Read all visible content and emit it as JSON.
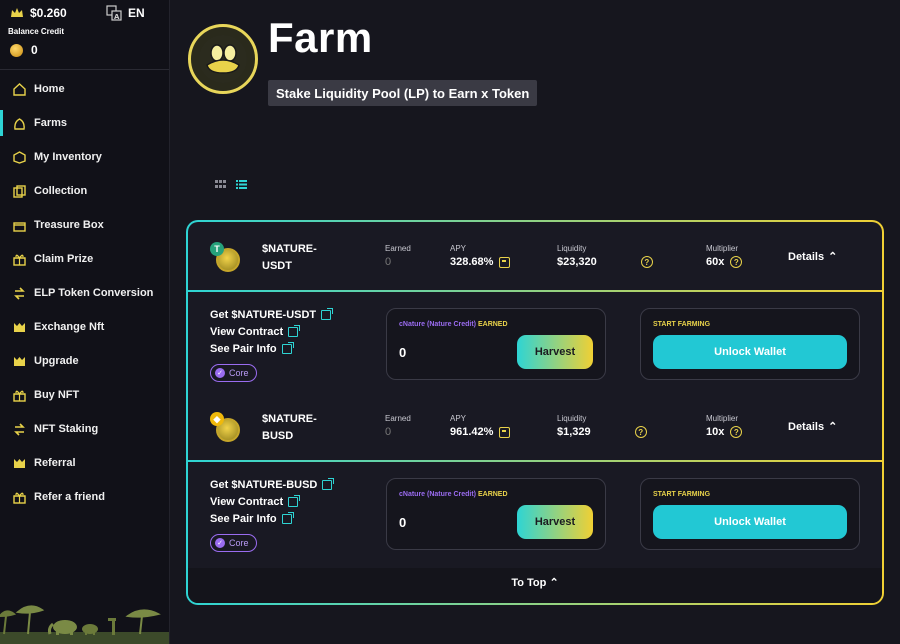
{
  "header_bar": {
    "price": "$0.260",
    "language": "EN",
    "balance_label": "Balance Credit",
    "balance_value": "0"
  },
  "sidebar": {
    "items": [
      {
        "label": "Home",
        "icon": "home-icon"
      },
      {
        "label": "Farms",
        "icon": "farm-icon",
        "active": true
      },
      {
        "label": "My Inventory",
        "icon": "inventory-icon"
      },
      {
        "label": "Collection",
        "icon": "collection-icon"
      },
      {
        "label": "Treasure Box",
        "icon": "treasure-box-icon"
      },
      {
        "label": "Claim Prize",
        "icon": "gift-icon"
      },
      {
        "label": "ELP Token Conversion",
        "icon": "conversion-icon"
      },
      {
        "label": "Exchange Nft",
        "icon": "exchange-icon"
      },
      {
        "label": "Upgrade",
        "icon": "upgrade-icon"
      },
      {
        "label": "Buy NFT",
        "icon": "gift-icon"
      },
      {
        "label": "NFT Staking",
        "icon": "staking-icon"
      },
      {
        "label": "Referral",
        "icon": "referral-icon"
      },
      {
        "label": "Refer a friend",
        "icon": "gift-icon"
      }
    ]
  },
  "page": {
    "title": "Farm",
    "subtitle": "Stake Liquidity Pool (LP) to Earn x Token"
  },
  "farms": [
    {
      "pair_line1": "$NATURE-",
      "pair_line2": "USDT",
      "quote_symbol": "T",
      "quote_color": "#26a17b",
      "earned_label": "Earned",
      "earned": "0",
      "apy_label": "APY",
      "apy": "328.68%",
      "liquidity_label": "Liquidity",
      "liquidity": "$23,320",
      "multiplier_label": "Multiplier",
      "multiplier": "60x",
      "details_label": "Details",
      "get_link": "Get $NATURE-USDT",
      "contract_link": "View Contract",
      "pair_link": "See Pair Info",
      "badge": "Core",
      "earn_token": "cNature (Nature Credit)",
      "earn_word": "EARNED",
      "earn_amount": "0",
      "harvest_label": "Harvest",
      "start_label": "START FARMING",
      "unlock_label": "Unlock Wallet"
    },
    {
      "pair_line1": "$NATURE-",
      "pair_line2": "BUSD",
      "quote_symbol": "◆",
      "quote_color": "#f0b90b",
      "earned_label": "Earned",
      "earned": "0",
      "apy_label": "APY",
      "apy": "961.42%",
      "liquidity_label": "Liquidity",
      "liquidity": "$1,329",
      "multiplier_label": "Multiplier",
      "multiplier": "10x",
      "details_label": "Details",
      "get_link": "Get $NATURE-BUSD",
      "contract_link": "View Contract",
      "pair_link": "See Pair Info",
      "badge": "Core",
      "earn_token": "cNature (Nature Credit)",
      "earn_word": "EARNED",
      "earn_amount": "0",
      "harvest_label": "Harvest",
      "start_label": "START FARMING",
      "unlock_label": "Unlock Wallet"
    }
  ],
  "to_top": "To Top",
  "colors": {
    "accent_cyan": "#2ed4d4",
    "accent_yellow": "#f0d034",
    "purple": "#9a6cf0"
  }
}
